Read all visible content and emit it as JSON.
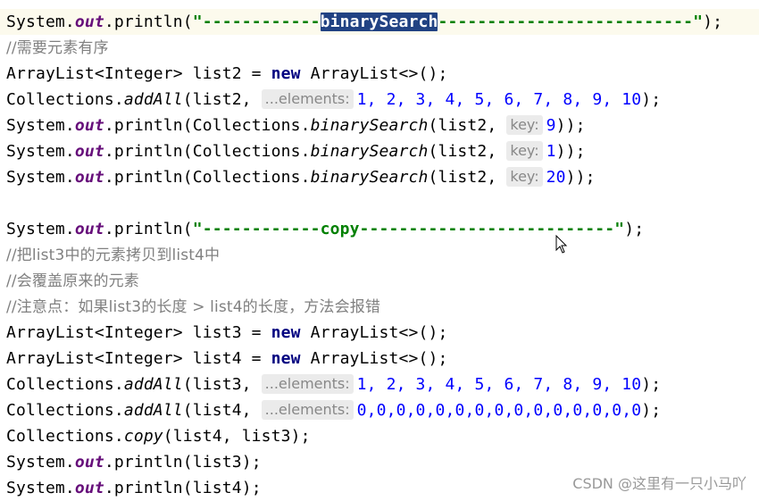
{
  "code": {
    "l1": {
      "a": "System.",
      "out": "out",
      "b": ".println(",
      "s1": "\"------------",
      "sel": "binarySearch",
      "s2": "--------------------------\"",
      "c": ");"
    },
    "l2": {
      "comment": "//需要元素有序"
    },
    "l3": {
      "a": "ArrayList<Integer> list2 = ",
      "kw": "new",
      "b": " ArrayList<>();"
    },
    "l4": {
      "a": "Collections.",
      "m": "addAll",
      "b": "(list2, ",
      "hint": "...elements:",
      "nums": "1, 2, 3, 4, 5, 6, 7, 8, 9, 10",
      "c": ");"
    },
    "l5": {
      "a": "System.",
      "out": "out",
      "b": ".println(Collections.",
      "m": "binarySearch",
      "c": "(list2, ",
      "hint": "key:",
      "num": "9",
      "d": "));"
    },
    "l6": {
      "a": "System.",
      "out": "out",
      "b": ".println(Collections.",
      "m": "binarySearch",
      "c": "(list2, ",
      "hint": "key:",
      "num": "1",
      "d": "));"
    },
    "l7": {
      "a": "System.",
      "out": "out",
      "b": ".println(Collections.",
      "m": "binarySearch",
      "c": "(list2, ",
      "hint": "key:",
      "num": "20",
      "d": "));"
    },
    "l9": {
      "a": "System.",
      "out": "out",
      "b": ".println(",
      "s": "\"------------copy--------------------------\"",
      "c": ");"
    },
    "l10": {
      "comment": "//把list3中的元素拷贝到list4中"
    },
    "l11": {
      "comment": "//会覆盖原来的元素"
    },
    "l12": {
      "comment": "//注意点：如果list3的长度 > list4的长度，方法会报错"
    },
    "l13": {
      "a": "ArrayList<Integer> list3 = ",
      "kw": "new",
      "b": " ArrayList<>();"
    },
    "l14": {
      "a": "ArrayList<Integer> list4 = ",
      "kw": "new",
      "b": " ArrayList<>();"
    },
    "l15": {
      "a": "Collections.",
      "m": "addAll",
      "b": "(list3, ",
      "hint": "...elements:",
      "nums": "1, 2, 3, 4, 5, 6, 7, 8, 9, 10",
      "c": ");"
    },
    "l16": {
      "a": "Collections.",
      "m": "addAll",
      "b": "(list4, ",
      "hint": "...elements:",
      "nums": "0,0,0,0,0,0,0,0,0,0,0,0,0,0,0",
      "c": ");"
    },
    "l17": {
      "a": "Collections.",
      "m": "copy",
      "b": "(list4, list3);"
    },
    "l18": {
      "a": "System.",
      "out": "out",
      "b": ".println(list3);"
    },
    "l19": {
      "a": "System.",
      "out": "out",
      "b": ".println(list4);"
    }
  },
  "watermark": "CSDN @这里有一只小马吖",
  "colors": {
    "keyword": "#000080",
    "field": "#660e7a",
    "string": "#008000",
    "number": "#0000ff",
    "comment": "#808080",
    "selection": "#214283"
  },
  "icons": {
    "cursor": "mouse-pointer-icon"
  }
}
